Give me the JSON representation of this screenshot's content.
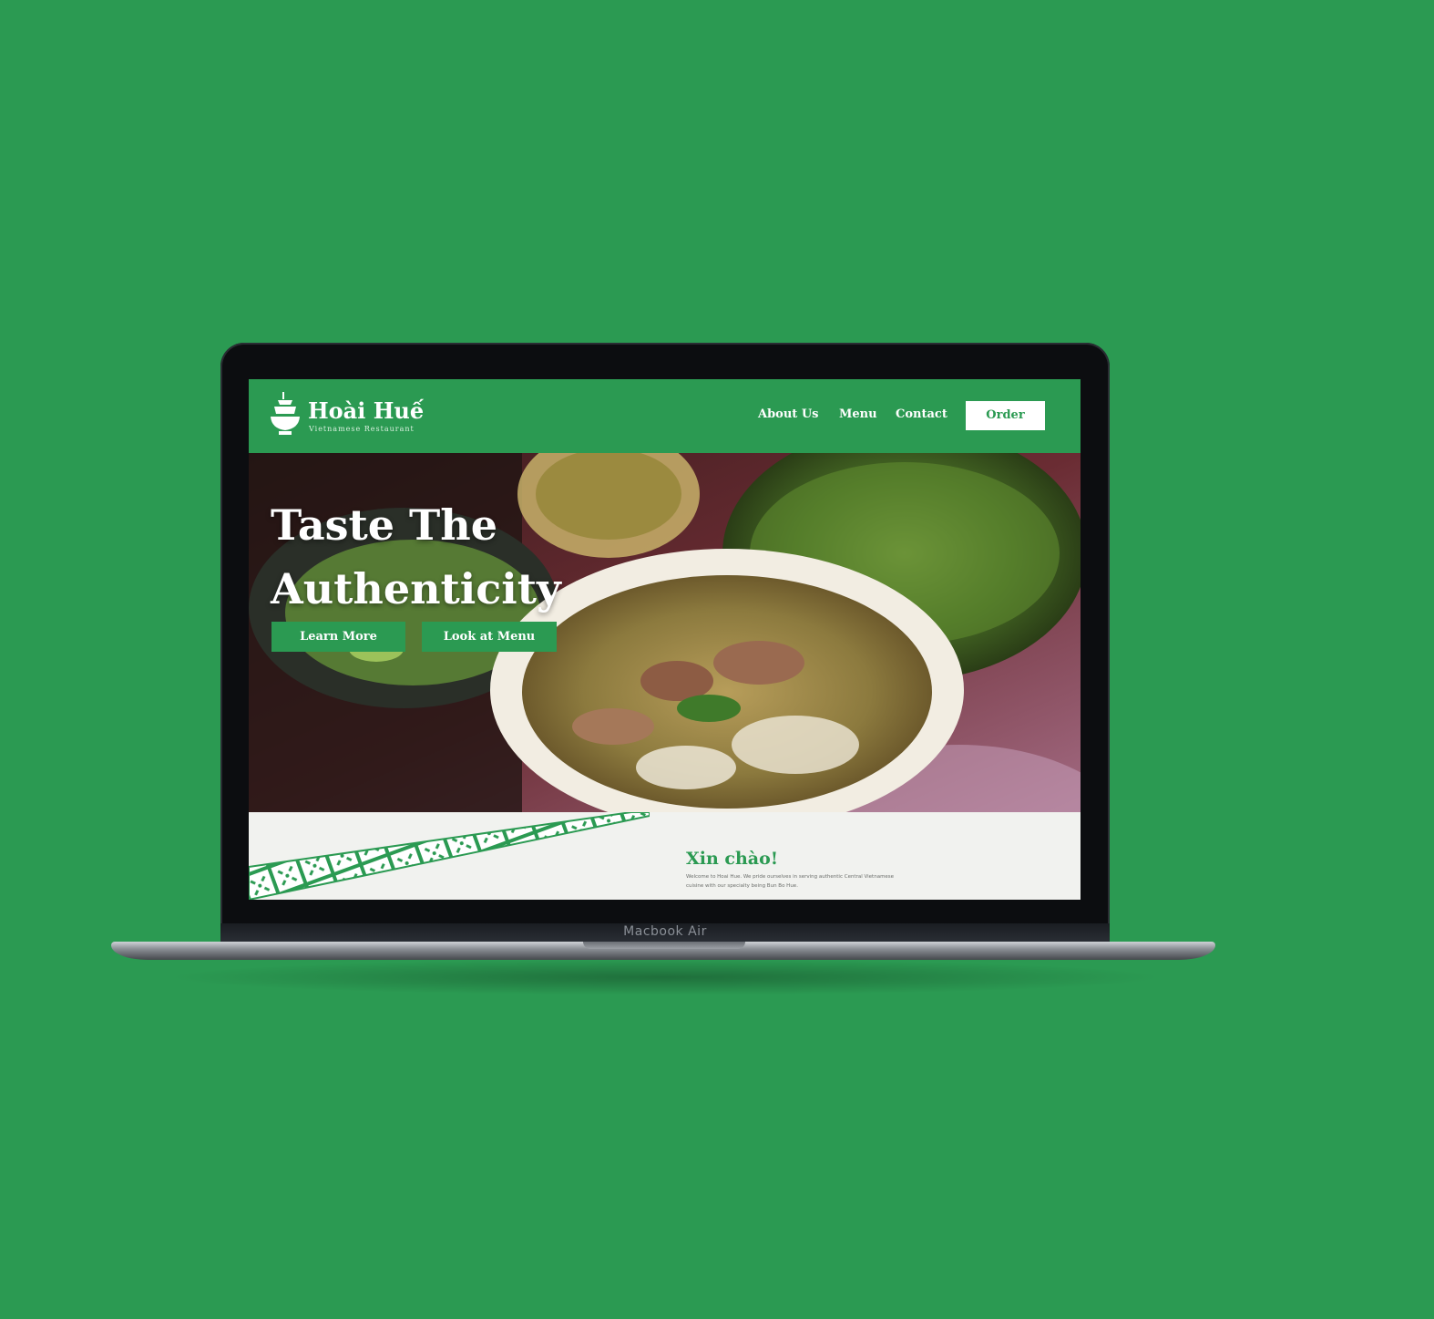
{
  "colors": {
    "background": "#2b9a52",
    "brand_green": "#2b9a52",
    "white": "#ffffff",
    "intro_bg": "#f1f2ef"
  },
  "device": {
    "label": "Macbook Air"
  },
  "site": {
    "logo": {
      "title": "Hoài Huế",
      "subtitle": "Vietnamese Restaurant",
      "icon": "bowl-icon"
    },
    "nav": {
      "about": "About Us",
      "menu": "Menu",
      "contact": "Contact",
      "order": "Order"
    },
    "hero": {
      "title": "Taste The Authenticity",
      "learn_more": "Learn More",
      "look_at_menu": "Look at Menu"
    },
    "intro": {
      "title": "Xin chào!",
      "text": "Welcome to Hoai Hue. We pride ourselves in serving authentic Central Vietnamese cuisine with our specialty being Bun Bo Hue."
    }
  }
}
